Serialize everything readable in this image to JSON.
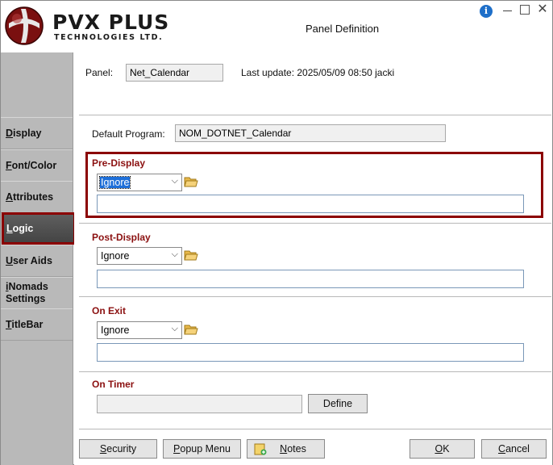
{
  "titlebar": {
    "brand_name": "PVX PLUS",
    "brand_sub": "TECHNOLOGIES LTD.",
    "window_title": "Panel Definition",
    "info_glyph": "i",
    "close_glyph": "✕"
  },
  "sidebar": {
    "items": [
      {
        "key": "D",
        "rest": "isplay",
        "active": false
      },
      {
        "key": "F",
        "rest": "ont/Color",
        "active": false
      },
      {
        "key": "A",
        "rest": "ttributes",
        "active": false
      },
      {
        "key": "L",
        "rest": "ogic",
        "active": true
      },
      {
        "key": "U",
        "rest": "ser Aids",
        "active": false
      },
      {
        "key": "i",
        "rest": "Nomads",
        "line2": "Settings",
        "active": false
      },
      {
        "key": "T",
        "rest": "itleBar",
        "active": false
      }
    ]
  },
  "panel": {
    "label": "Panel:",
    "value": "Net_Calendar",
    "last_update": "Last update: 2025/05/09 08:50 jacki"
  },
  "default_program": {
    "label": "Default Program:",
    "value": "NOM_DOTNET_Calendar"
  },
  "sections": {
    "pre_display": {
      "title": "Pre-Display",
      "select_value": "Ignore",
      "text": ""
    },
    "post_display": {
      "title": "Post-Display",
      "select_value": "Ignore",
      "text": ""
    },
    "on_exit": {
      "title": "On Exit",
      "select_value": "Ignore",
      "text": ""
    },
    "on_timer": {
      "title": "On Timer",
      "value": "",
      "define_label": "Define"
    }
  },
  "buttons": {
    "security": {
      "key": "S",
      "rest": "ecurity"
    },
    "popup_menu": {
      "key": "P",
      "rest": "opup Menu"
    },
    "notes": {
      "key": "N",
      "rest": "otes"
    },
    "ok": {
      "key": "O",
      "rest": "K"
    },
    "cancel": {
      "key": "C",
      "rest": "ancel"
    }
  },
  "colors": {
    "accent_red": "#8b0000",
    "section_title": "#8b1010",
    "selection_blue": "#1e6fd9"
  },
  "icons": [
    "logo-globe-icon",
    "info-icon",
    "minimize-icon",
    "maximize-icon",
    "close-icon",
    "folder-icon",
    "chevron-down-icon",
    "notes-icon"
  ]
}
